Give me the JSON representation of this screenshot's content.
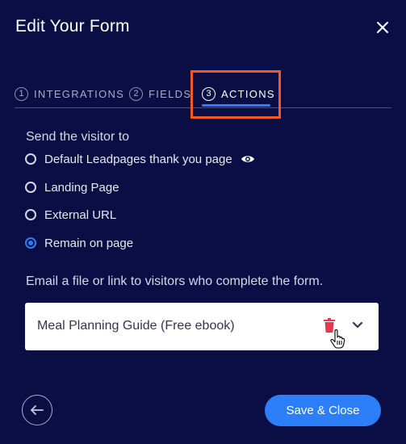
{
  "modal": {
    "title": "Edit Your Form"
  },
  "tabs": [
    {
      "number": "1",
      "label": "INTEGRATIONS"
    },
    {
      "number": "2",
      "label": "FIELDS"
    },
    {
      "number": "3",
      "label": "ACTIONS"
    }
  ],
  "active_tab": "ACTIONS",
  "send_section": {
    "label": "Send the visitor to",
    "options": [
      {
        "label": "Default Leadpages thank you page",
        "checked": false
      },
      {
        "label": "Landing Page",
        "checked": false
      },
      {
        "label": "External URL",
        "checked": false
      },
      {
        "label": "Remain on page",
        "checked": true
      }
    ]
  },
  "email_section": {
    "label": "Email a file or link to visitors who complete the form.",
    "selected_value": "Meal Planning Guide (Free ebook)"
  },
  "footer": {
    "save_label": "Save & Close"
  },
  "colors": {
    "background": "#0b0e45",
    "accent": "#2d7ff9",
    "highlight": "#f15a24",
    "delete": "#e8384f"
  }
}
